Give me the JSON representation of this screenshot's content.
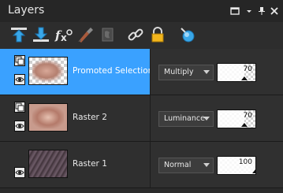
{
  "panel": {
    "title": "Layers"
  },
  "title_icons": [
    "window-icon",
    "menu-arrow-icon",
    "pin-icon",
    "close-icon"
  ],
  "toolbar": {
    "tools": [
      "move-layer-up-icon",
      "move-layer-down-icon",
      "effects-fx-icon",
      "paint-brush-icon",
      "mask-icon",
      "link-icon",
      "lock-icon",
      "visibility-toggle-icon"
    ]
  },
  "layers": [
    {
      "name": "Promoted Selection",
      "blend_mode": "Multiply",
      "opacity": "70",
      "opacity_fraction": 0.7,
      "selected": true,
      "thumb": "portrait-checker"
    },
    {
      "name": "Raster 2",
      "blend_mode": "Luminance",
      "opacity": "70",
      "opacity_fraction": 0.7,
      "selected": false,
      "thumb": "portrait-solid"
    },
    {
      "name": "Raster 1",
      "blend_mode": "Normal",
      "opacity": "100",
      "opacity_fraction": 1.0,
      "selected": false,
      "thumb": "texture-dark"
    }
  ],
  "colors": {
    "selection": "#3aa1ff",
    "panel_bg": "#2d2d2d",
    "tool_accent": "#39a7e8"
  }
}
